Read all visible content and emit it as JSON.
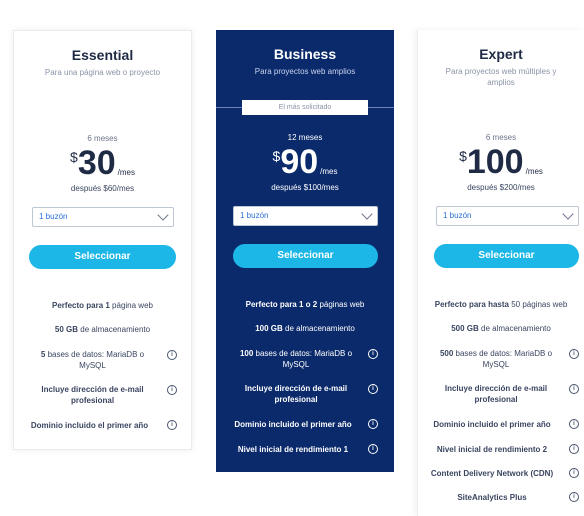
{
  "plans": [
    {
      "name": "Essential",
      "subtitle": "Para una página web o proyecto",
      "term": "6 meses",
      "currency": "$",
      "price": "30",
      "per": "/mes",
      "after": "después $60/mes",
      "mailbox": "1 buzón",
      "button": "Seleccionar",
      "features": [
        {
          "strong": "Perfecto para 1",
          "text": " página web"
        },
        {
          "strong": "50 GB",
          "text": " de almacenamiento"
        },
        {
          "strong": "5",
          "text": " bases de datos: MariaDB o MySQL",
          "info": true
        },
        {
          "strong": "Incluye dirección de e-mail profesional",
          "text": "",
          "info": true
        },
        {
          "strong": "Dominio incluido el primer año",
          "text": "",
          "info": true
        }
      ]
    },
    {
      "name": "Business",
      "subtitle": "Para proyectos web amplios",
      "badge": "El más solicitado",
      "term": "12 meses",
      "currency": "$",
      "price": "90",
      "per": "/mes",
      "after": "después $100/mes",
      "mailbox": "1 buzón",
      "button": "Seleccionar",
      "features": [
        {
          "strong": "Perfecto para 1 o 2",
          "text": " páginas web"
        },
        {
          "strong": "100 GB",
          "text": " de almacenamiento"
        },
        {
          "strong": "100",
          "text": " bases de datos: MariaDB o MySQL",
          "info": true
        },
        {
          "strong": "Incluye dirección de e-mail profesional",
          "text": "",
          "info": true
        },
        {
          "strong": "Dominio incluido el primer año",
          "text": "",
          "info": true
        },
        {
          "strong": "Nivel inicial de rendimiento 1",
          "text": "",
          "info": true
        }
      ]
    },
    {
      "name": "Expert",
      "subtitle": "Para proyectos web múltiples y amplios",
      "term": "6 meses",
      "currency": "$",
      "price": "100",
      "per": "/mes",
      "after": "después $200/mes",
      "mailbox": "1 buzón",
      "button": "Seleccionar",
      "features": [
        {
          "strong": "Perfecto para hasta",
          "text": " 50 páginas web"
        },
        {
          "strong": "500 GB",
          "text": " de almacenamiento"
        },
        {
          "strong": "500",
          "text": " bases de datos: MariaDB o MySQL",
          "info": true
        },
        {
          "strong": "Incluye dirección de e-mail profesional",
          "text": "",
          "info": true
        },
        {
          "strong": "Dominio incluido el primer año",
          "text": "",
          "info": true
        },
        {
          "strong": "Nivel inicial de rendimiento 2",
          "text": "",
          "info": true
        },
        {
          "strong": "Content Delivery Network (CDN)",
          "text": "",
          "info": true
        },
        {
          "strong": "SiteAnalytics Plus",
          "text": "",
          "info": true
        }
      ]
    }
  ]
}
